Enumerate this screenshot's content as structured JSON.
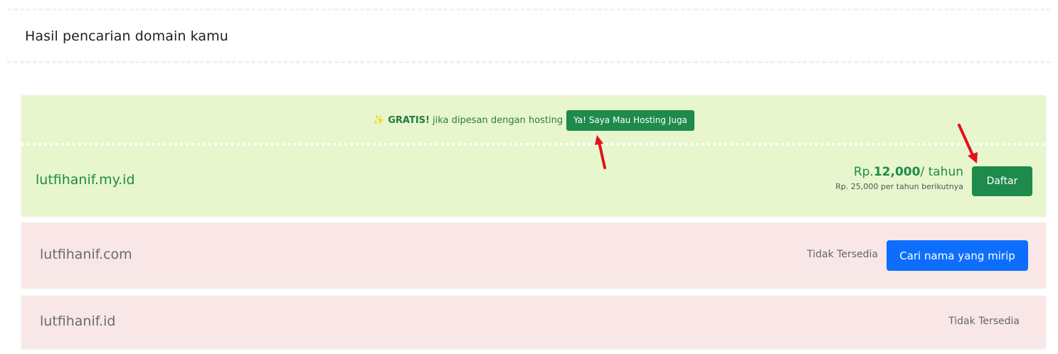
{
  "header": {
    "title": "Hasil pencarian domain kamu"
  },
  "promo": {
    "sparkle_icon": "sparkles-icon",
    "gratis_label": "GRATIS!",
    "text": "jika dipesan dengan hosting",
    "hosting_button_label": "Ya! Saya Mau Hosting Juga"
  },
  "available": {
    "domain": "lutfihanif.my.id",
    "price_prefix": "Rp.",
    "price_amount": "12,000",
    "price_suffix": "/ tahun",
    "renewal_text": "Rp. 25,000 per tahun berikutnya",
    "register_button_label": "Daftar"
  },
  "unavailable": [
    {
      "domain": "lutfihanif.com",
      "status": "Tidak Tersedia",
      "button_label": "Cari nama yang mirip"
    },
    {
      "domain": "lutfihanif.id",
      "status": "Tidak Tersedia"
    }
  ],
  "colors": {
    "available_bg": "#e7f6cc",
    "unavailable_bg": "#f9e7e7",
    "primary_green": "#1e8a4c",
    "primary_blue": "#0d6efd",
    "annotation_arrow": "#e5111a"
  }
}
